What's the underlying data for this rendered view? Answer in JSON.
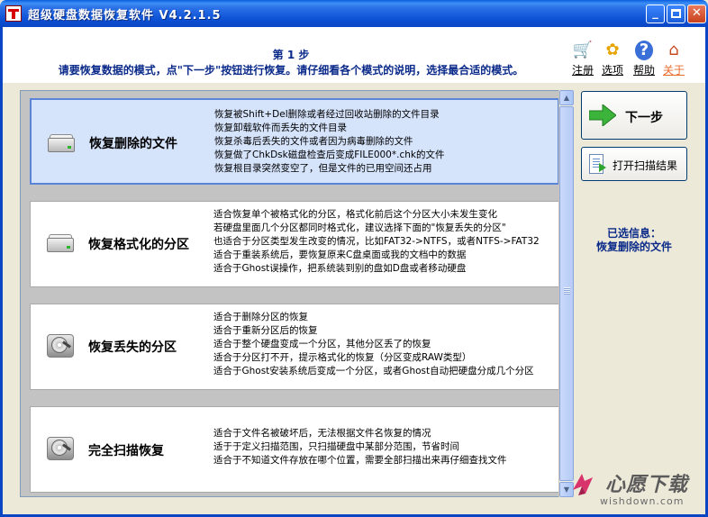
{
  "window": {
    "title": "超级硬盘数据恢复软件 V4.2.1.5",
    "controls": {
      "minimize": "_",
      "maximize": "□",
      "close": "✕"
    }
  },
  "header": {
    "step": "第 1 步",
    "instruction": "请要恢复数据的模式，点\"下一步\"按钮进行恢复。请仔细看各个模式的说明，选择最合适的模式。",
    "toolbar": [
      {
        "label": "注册",
        "icon": "cart-icon"
      },
      {
        "label": "选项",
        "icon": "gear-icon"
      },
      {
        "label": "帮助",
        "icon": "help-icon"
      },
      {
        "label": "关于",
        "icon": "home-icon"
      }
    ]
  },
  "options": [
    {
      "title": "恢复删除的文件",
      "icon": "hard-disk-icon",
      "selected": true,
      "description": [
        "恢复被Shift+Del删除或者经过回收站删除的文件目录",
        "恢复卸载软件而丢失的文件目录",
        "恢复杀毒后丢失的文件或者因为病毒删除的文件",
        "恢复做了ChkDsk磁盘检查后变成FILE000*.chk的文件",
        "恢复根目录突然变空了，但是文件的已用空间还占用"
      ]
    },
    {
      "title": "恢复格式化的分区",
      "icon": "hard-disk-icon",
      "selected": false,
      "description": [
        "适合恢复单个被格式化的分区，格式化前后这个分区大小未发生变化",
        "若硬盘里面几个分区都同时格式化，建议选择下面的\"恢复丢失的分区\"",
        "也适合于分区类型发生改变的情况，比如FAT32->NTFS，或者NTFS->FAT32",
        "适合于重装系统后，要恢复原来C盘桌面或我的文档中的数据",
        "适合于Ghost误操作，把系统装到别的盘如D盘或者移动硬盘"
      ]
    },
    {
      "title": "恢复丢失的分区",
      "icon": "open-hard-disk-icon",
      "selected": false,
      "description": [
        "适合于删除分区的恢复",
        "适合于重新分区后的恢复",
        "适合于整个硬盘变成一个分区，其他分区丢了的恢复",
        "适合于分区打不开，提示格式化的恢复（分区变成RAW类型）",
        "适合于Ghost安装系统后变成一个分区，或者Ghost自动把硬盘分成几个分区"
      ]
    },
    {
      "title": "完全扫描恢复",
      "icon": "open-hard-disk-icon",
      "selected": false,
      "description": [
        "适合于文件名被破坏后，无法根据文件名恢复的情况",
        "适于于定义扫描范围，只扫描硬盘中某部分范围，节省时间",
        "适合于不知道文件存放在哪个位置，需要全部扫描出来再仔细查找文件"
      ]
    }
  ],
  "buttons": {
    "next": "下一步",
    "open_scan": "打开扫描结果"
  },
  "selected_info": {
    "label": "已选信息：",
    "value": "恢复删除的文件"
  },
  "watermark": {
    "brand": "心愿下载",
    "url": "wishdown.com"
  },
  "colors": {
    "titlebar": "#0a5ddf",
    "accent_text": "#0a2a8a",
    "selected_bg": "#d5e3fb",
    "about_label": "#e86b2a"
  }
}
